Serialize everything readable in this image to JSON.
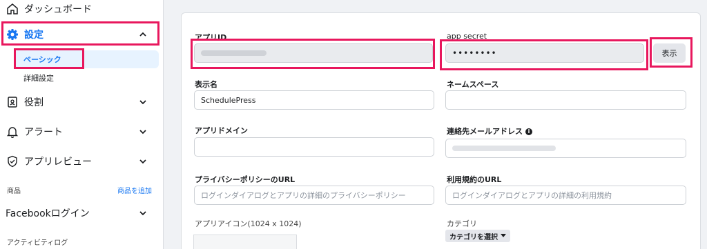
{
  "sidebar": {
    "dashboard": {
      "label": "ダッシュボード",
      "icon": "home-icon"
    },
    "settings": {
      "label": "設定",
      "icon": "gear-icon",
      "expanded": true
    },
    "settings_sub": [
      {
        "label": "ベーシック",
        "active": true
      },
      {
        "label": "詳細設定",
        "active": false
      }
    ],
    "roles": {
      "label": "役割",
      "icon": "id-badge-icon"
    },
    "alerts": {
      "label": "アラート",
      "icon": "bell-icon"
    },
    "app_review": {
      "label": "アプリレビュー",
      "icon": "shield-check-icon"
    },
    "products": {
      "heading": "商品",
      "add_link": "商品を追加"
    },
    "facebook_login": {
      "label": "Facebookログイン"
    },
    "activity_log": {
      "heading": "アクティビティログ"
    }
  },
  "form": {
    "app_id": {
      "label": "アプリID"
    },
    "app_secret": {
      "label": "app secret",
      "value": "••••••••",
      "show_button": "表示"
    },
    "display_name": {
      "label": "表示名",
      "value": "SchedulePress"
    },
    "namespace": {
      "label": "ネームスペース",
      "value": ""
    },
    "app_domains": {
      "label": "アプリドメイン",
      "value": ""
    },
    "contact_email": {
      "label": "連絡先メールアドレス"
    },
    "privacy_url": {
      "label": "プライバシーポリシーのURL",
      "placeholder": "ログインダイアログとアプリの詳細のプライバシーポリシー"
    },
    "terms_url": {
      "label": "利用規約のURL",
      "placeholder": "ログインダイアログとアプリの詳細の利用規約"
    },
    "app_icon": {
      "label": "アプリアイコン(1024 x 1024)"
    },
    "category": {
      "label": "カテゴリ",
      "select_label": "カテゴリを選択"
    }
  },
  "colors": {
    "accent": "#1877f2",
    "highlight": "#e8175d",
    "panel_bg": "#ffffff",
    "page_bg": "#f0f2f5"
  }
}
